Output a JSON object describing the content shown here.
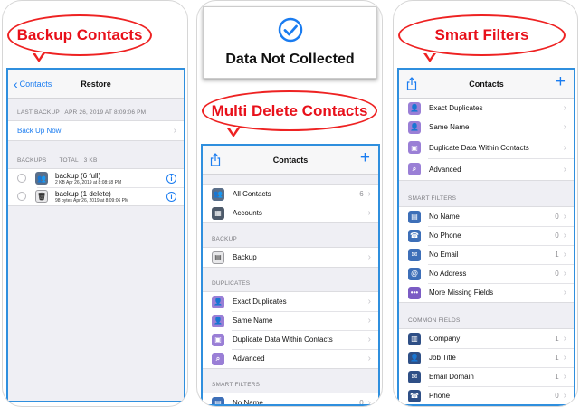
{
  "panel1": {
    "bubble": "Backup Contacts",
    "nav": {
      "back": "Contacts",
      "title": "Restore"
    },
    "last_backup": "LAST BACKUP : APR 26, 2019 AT 8:09:06 PM",
    "backup_now": "Back Up Now",
    "backups_label": "BACKUPS",
    "total_label": "TOTAL : 3 KB",
    "backups": [
      {
        "name": "backup (6 full)",
        "detail": "2 KB  Apr 26, 2019 at 8:08:18 PM"
      },
      {
        "name": "backup (1 delete)",
        "detail": "98 bytes  Apr 26, 2019 at 8:09:06 PM"
      }
    ]
  },
  "panel2": {
    "banner": "Data Not Collected",
    "bubble": "Multi Delete Contacts",
    "nav": {
      "title": "Contacts"
    },
    "main": [
      {
        "label": "All Contacts",
        "count": "6"
      },
      {
        "label": "Accounts",
        "count": ""
      }
    ],
    "backup_label": "BACKUP",
    "backup": [
      {
        "label": "Backup",
        "count": ""
      }
    ],
    "duplicates_label": "DUPLICATES",
    "duplicates": [
      {
        "label": "Exact Duplicates",
        "count": ""
      },
      {
        "label": "Same Name",
        "count": ""
      },
      {
        "label": "Duplicate Data Within Contacts",
        "count": ""
      },
      {
        "label": "Advanced",
        "count": ""
      }
    ],
    "smart_label": "SMART FILTERS",
    "smart": [
      {
        "label": "No Name",
        "count": "0"
      }
    ]
  },
  "panel3": {
    "bubble": "Smart Filters",
    "nav": {
      "title": "Contacts"
    },
    "duplicates": [
      {
        "label": "Exact Duplicates",
        "count": ""
      },
      {
        "label": "Same Name",
        "count": ""
      },
      {
        "label": "Duplicate Data Within Contacts",
        "count": ""
      },
      {
        "label": "Advanced",
        "count": ""
      }
    ],
    "smart_label": "SMART FILTERS",
    "smart": [
      {
        "label": "No Name",
        "count": "0"
      },
      {
        "label": "No Phone",
        "count": "0"
      },
      {
        "label": "No Email",
        "count": "1"
      },
      {
        "label": "No Address",
        "count": "0"
      },
      {
        "label": "More Missing Fields",
        "count": ""
      }
    ],
    "common_label": "COMMON FIELDS",
    "common": [
      {
        "label": "Company",
        "count": "1"
      },
      {
        "label": "Job Title",
        "count": "1"
      },
      {
        "label": "Email Domain",
        "count": "1"
      },
      {
        "label": "Phone",
        "count": "0"
      }
    ]
  },
  "colors": {
    "accent": "#1a7cf0",
    "bubble_red": "#e8101a",
    "screen_border": "#2f8fde"
  }
}
